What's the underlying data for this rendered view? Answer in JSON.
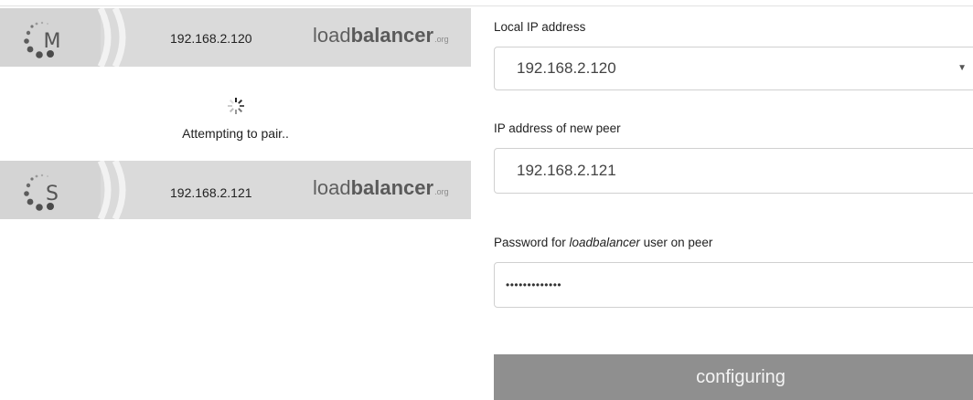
{
  "master": {
    "badge_letter": "M",
    "ip": "192.168.2.120",
    "logo": {
      "regular": "load",
      "bold": "balancer",
      "suffix": ".org"
    }
  },
  "pairing": {
    "status_text": "Attempting to pair.."
  },
  "slave": {
    "badge_letter": "S",
    "ip": "192.168.2.121",
    "logo": {
      "regular": "load",
      "bold": "balancer",
      "suffix": ".org"
    }
  },
  "form": {
    "local_ip": {
      "label": "Local IP address",
      "selected": "192.168.2.120"
    },
    "peer_ip": {
      "label": "IP address of new peer",
      "value": "192.168.2.121"
    },
    "password": {
      "label_prefix": "Password for ",
      "label_em": "loadbalancer",
      "label_suffix": " user on peer",
      "masked_value": "•••••••••••••"
    },
    "submit_label": "configuring"
  },
  "colors": {
    "card_bg": "#dadada",
    "button_bg": "#8f8f8f",
    "dot_dark": "#5b5b5b"
  }
}
